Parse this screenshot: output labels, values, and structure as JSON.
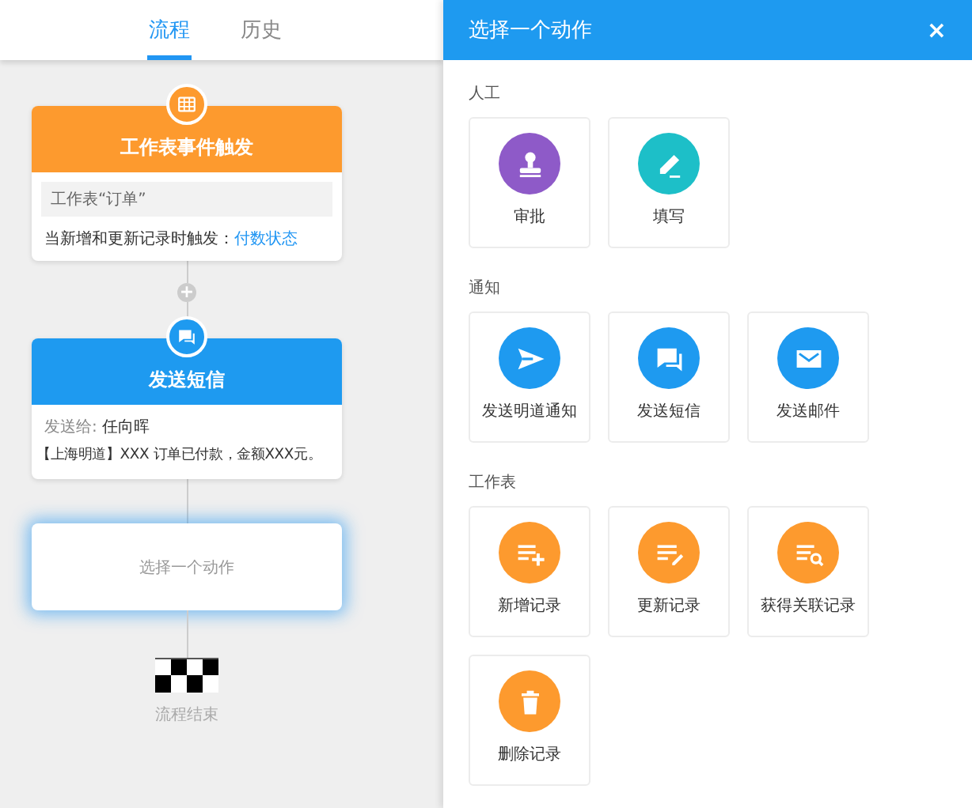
{
  "tabs": [
    {
      "label": "流程",
      "selected": true
    },
    {
      "label": "历史",
      "selected": false
    }
  ],
  "flow": {
    "trigger": {
      "kind": "grid",
      "title": "工作表事件触发",
      "sheet": "工作表“订单”",
      "condition": "当新增和更新记录时触发：",
      "field": "付数状态"
    },
    "add_button": "+",
    "sms": {
      "kind": "chat",
      "title": "发送短信",
      "recipient_label": "发送给:",
      "recipient": "任向晖",
      "message": "【上海明道】XXX 订单已付款，金额XXX元。"
    },
    "placeholder": {
      "label": "选择一个动作",
      "highlighted": true
    },
    "end": {
      "label": "流程结束"
    }
  },
  "panel": {
    "title": "选择一个动作",
    "close": "×",
    "sections": [
      {
        "label": "人工",
        "actions": [
          {
            "label": "审批",
            "kind": "stamp",
            "color": "#8e5ac8"
          },
          {
            "label": "填写",
            "kind": "pen",
            "color": "#1dbfc8"
          }
        ]
      },
      {
        "label": "通知",
        "actions": [
          {
            "label": "发送明道通知",
            "kind": "send",
            "color": "#1e9af0"
          },
          {
            "label": "发送短信",
            "kind": "chat",
            "color": "#1e9af0"
          },
          {
            "label": "发送邮件",
            "kind": "mail",
            "color": "#1e9af0"
          }
        ]
      },
      {
        "label": "工作表",
        "actions": [
          {
            "label": "新增记录",
            "kind": "add",
            "color": "#fd9a2e"
          },
          {
            "label": "更新记录",
            "kind": "edit",
            "color": "#fd9a2e"
          },
          {
            "label": "获得关联记录",
            "kind": "lookup",
            "color": "#fd9a2e"
          },
          {
            "label": "删除记录",
            "kind": "trash",
            "color": "#fd9a2e"
          }
        ]
      }
    ]
  }
}
